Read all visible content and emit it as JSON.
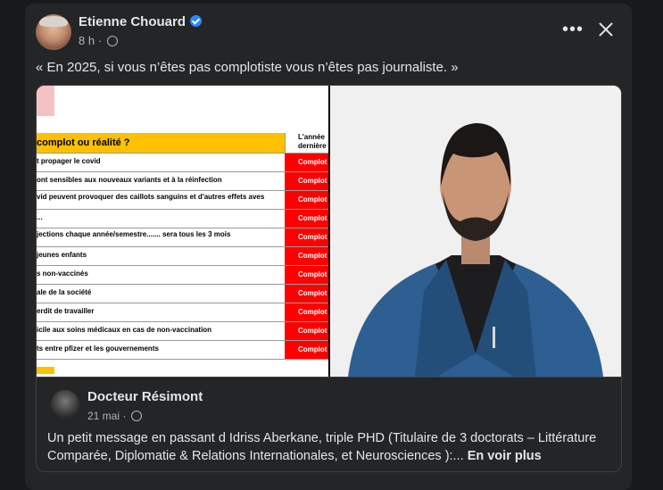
{
  "post": {
    "author": "Etienne Chouard",
    "time": "8 h",
    "time_sep": "·",
    "text": "« En 2025, si vous n’êtes pas complotiste vous n’êtes pas journaliste. »"
  },
  "image_left": {
    "header_title": "complot ou réalité ?",
    "header_col": "L'année dernière",
    "rows": [
      {
        "text": "t propager le covid",
        "tag": "Complot"
      },
      {
        "text": "ont sensibles aux nouveaux variants et à la réinfection",
        "tag": "Complot"
      },
      {
        "text": "vid peuvent provoquer des caillots sanguins et d'autres effets aves",
        "tag": "Complot"
      },
      {
        "text": "...",
        "tag": "Complot"
      },
      {
        "text": "jections chaque année/semestre....... sera tous les 3 mois",
        "tag": "Complot"
      },
      {
        "text": "jeunes enfants",
        "tag": "Complot"
      },
      {
        "text": "s non-vaccinés",
        "tag": "Complot"
      },
      {
        "text": "ale de la société",
        "tag": "Complot"
      },
      {
        "text": "erdit de travailler",
        "tag": "Complot"
      },
      {
        "text": "icile aux soins médicaux en cas de non-vaccination",
        "tag": "Complot"
      },
      {
        "text": "ts entre pfizer et les gouvernements",
        "tag": "Complot"
      }
    ]
  },
  "link": {
    "name": "Docteur Résimont",
    "date": "21 mai",
    "date_sep": "·",
    "text": "Un petit message en passant d Idriss Aberkane, triple PHD (Titulaire de 3 doctorats – Littérature Comparée, Diplomatie & Relations Internationales,  et Neurosciences ):...",
    "see_more": "En voir plus"
  },
  "icons": {
    "more": "more-horizontal-icon",
    "close": "close-icon",
    "audience": "globe-icon",
    "verified": "verified-badge-icon"
  },
  "colors": {
    "background": "#18191a",
    "card": "#242526",
    "text": "#e4e6eb",
    "secondary_text": "#b0b3b8",
    "verified": "#2d88ff",
    "complot_tag": "#ff0000",
    "table_header": "#ffc000"
  }
}
